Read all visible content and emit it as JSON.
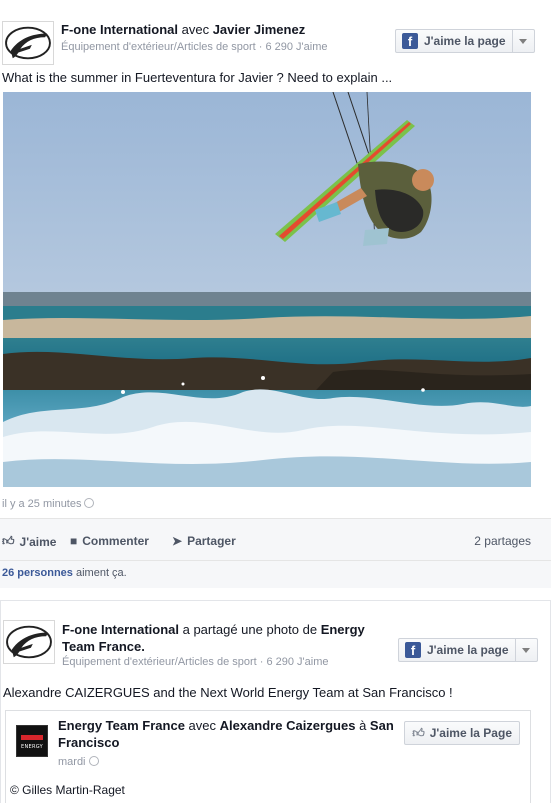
{
  "post1": {
    "page_name": "F-one International",
    "with_text": " avec ",
    "tagged": "Javier Jimenez",
    "subtitle": "Équipement d'extérieur/Articles de sport · 6 290 J'aime",
    "like_page_label": "J'aime la page",
    "message": "What is the summer in Fuerteventura for Javier ? Need to explain ...",
    "timestamp": "il y a 25 minutes",
    "actions": {
      "like": "J'aime",
      "comment": "Commenter",
      "share": "Partager"
    },
    "shares": "2 partages",
    "likes_count": "26 personnes",
    "likes_suffix": " aiment ça."
  },
  "post2": {
    "page_name": "F-one International",
    "shared_text_1": " a partagé une photo de ",
    "shared_from": "Energy",
    "shared_from_2": "Team France",
    "shared_end": ".",
    "subtitle": "Équipement d'extérieur/Articles de sport · 6 290 J'aime",
    "like_page_label": "J'aime la page",
    "message": "Alexandre CAIZERGUES and the Next World Energy Team at San Francisco !",
    "shared_card": {
      "logo_text": "ENERGY",
      "author": "Energy Team France",
      "with_text": " avec ",
      "tagged": "Alexandre Caizergues",
      "at_text": " à ",
      "place": "San Francisco",
      "date": "mardi",
      "like_label": "J'aime la Page",
      "credit": "© Gilles Martin-Raget"
    }
  },
  "icons": [
    "f-one-logo-icon",
    "facebook-icon",
    "chevron-down-icon",
    "globe-icon",
    "thumbs-up-icon",
    "comment-icon",
    "share-arrow-icon"
  ]
}
